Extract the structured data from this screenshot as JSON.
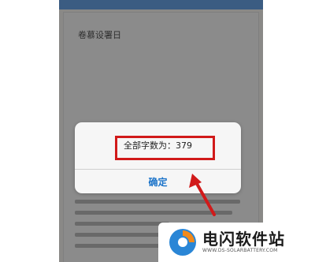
{
  "document": {
    "title": "卷慕设署日"
  },
  "alert": {
    "message": "全部字数为：379",
    "confirm_label": "确定"
  },
  "watermark": {
    "brand": "电闪软件站",
    "url": "WWW.DS-SOLARBATTERY.COM"
  },
  "colors": {
    "annotation": "#d11a1a",
    "button_text": "#1a73c9",
    "brand_blue": "#2a86d6",
    "brand_orange": "#f28a1b"
  }
}
